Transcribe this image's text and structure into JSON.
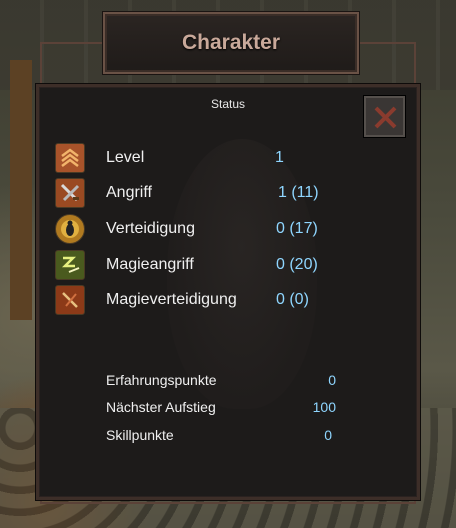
{
  "window": {
    "title": "Charakter",
    "section": "Status"
  },
  "stats": [
    {
      "label": "Level",
      "value": "1",
      "icon": "level-chevrons-icon"
    },
    {
      "label": "Angriff",
      "value": "1  (11)",
      "icon": "attack-swords-icon"
    },
    {
      "label": "Verteidigung",
      "value": "0  (17)",
      "icon": "defense-beetle-icon"
    },
    {
      "label": "Magieangriff",
      "value": "0  (20)",
      "icon": "magic-attack-icon"
    },
    {
      "label": "Magieverteidigung",
      "value": "0  (0)",
      "icon": "magic-defense-icon"
    }
  ],
  "info": [
    {
      "label": "Erfahrungspunkte",
      "value": "0"
    },
    {
      "label": "Nächster Aufstieg",
      "value": "100"
    },
    {
      "label": "Skillpunkte",
      "value": "0"
    }
  ],
  "colors": {
    "value": "#8fd6ff",
    "title": "#c9a99a",
    "close_x": "#8a3b2e"
  }
}
